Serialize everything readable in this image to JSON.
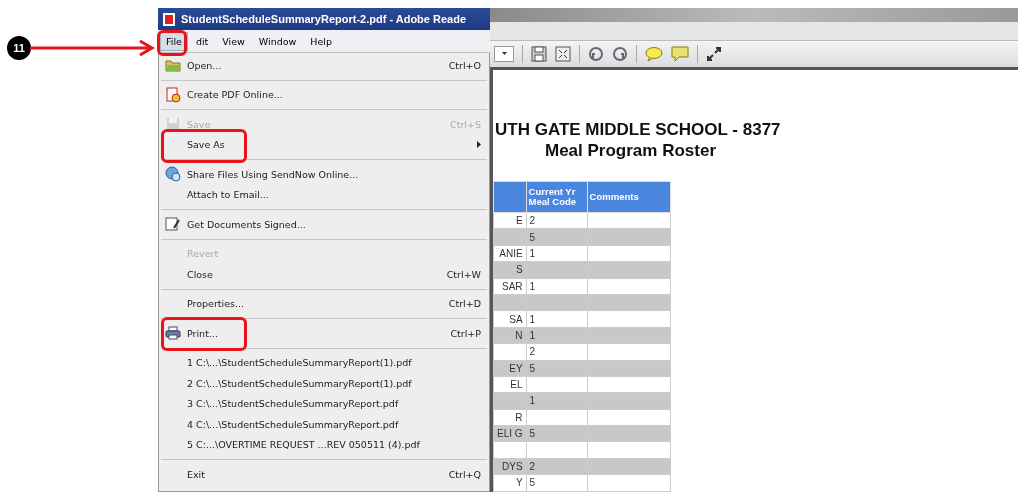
{
  "step_marker": {
    "number": "11"
  },
  "window": {
    "title": "StudentScheduleSummaryReport-2.pdf - Adobe Reade"
  },
  "menu_bar": [
    {
      "label": "File",
      "selected": true,
      "highlighted": true
    },
    {
      "label": "dit",
      "selected": false,
      "highlighted": false
    },
    {
      "label": "View",
      "selected": false,
      "highlighted": false
    },
    {
      "label": "Window",
      "selected": false,
      "highlighted": false
    },
    {
      "label": "Help",
      "selected": false,
      "highlighted": false
    }
  ],
  "file_menu": [
    {
      "kind": "item",
      "label": "Open...",
      "shortcut": "Ctrl+O",
      "disabled": false,
      "highlighted": false
    },
    {
      "kind": "separator"
    },
    {
      "kind": "item",
      "label": "Create PDF Online...",
      "disabled": false,
      "highlighted": false
    },
    {
      "kind": "separator"
    },
    {
      "kind": "item",
      "label": "Save",
      "shortcut": "Ctrl+S",
      "disabled": true,
      "highlighted": false
    },
    {
      "kind": "submenu",
      "label": "Save As",
      "disabled": false,
      "highlighted": true
    },
    {
      "kind": "separator"
    },
    {
      "kind": "item",
      "label": "Share Files Using SendNow Online...",
      "disabled": false,
      "highlighted": false
    },
    {
      "kind": "item",
      "label": "Attach to Email...",
      "disabled": false,
      "highlighted": false
    },
    {
      "kind": "separator"
    },
    {
      "kind": "item",
      "label": "Get Documents Signed...",
      "disabled": false,
      "highlighted": false
    },
    {
      "kind": "separator"
    },
    {
      "kind": "item",
      "label": "Revert",
      "disabled": true,
      "highlighted": false
    },
    {
      "kind": "item",
      "label": "Close",
      "shortcut": "Ctrl+W",
      "disabled": false,
      "highlighted": false
    },
    {
      "kind": "separator"
    },
    {
      "kind": "item",
      "label": "Properties...",
      "shortcut": "Ctrl+D",
      "disabled": false,
      "highlighted": false
    },
    {
      "kind": "separator"
    },
    {
      "kind": "item",
      "label": "Print...",
      "shortcut": "Ctrl+P",
      "disabled": false,
      "highlighted": true
    },
    {
      "kind": "separator"
    },
    {
      "kind": "item",
      "label": "1 C:\\...\\StudentScheduleSummaryReport(1).pdf",
      "disabled": false,
      "highlighted": false
    },
    {
      "kind": "item",
      "label": "2 C:\\...\\StudentScheduleSummaryReport(1).pdf",
      "disabled": false,
      "highlighted": false
    },
    {
      "kind": "item",
      "label": "3 C:\\...\\StudentScheduleSummaryReport.pdf",
      "disabled": false,
      "highlighted": false
    },
    {
      "kind": "item",
      "label": "4 C:\\...\\StudentScheduleSummaryReport.pdf",
      "disabled": false,
      "highlighted": false
    },
    {
      "kind": "item",
      "label": "5 C:...\\OVERTIME REQUEST ...REV 050511 (4).pdf",
      "disabled": false,
      "highlighted": false
    },
    {
      "kind": "separator"
    },
    {
      "kind": "item",
      "label": "Exit",
      "shortcut": "Ctrl+Q",
      "disabled": false,
      "highlighted": false
    }
  ],
  "document": {
    "title": "UTH GATE MIDDLE SCHOOL - 8377",
    "subtitle": "Meal Program Roster",
    "table": {
      "columns": [
        "",
        "Current Yr Meal Code",
        "Comments"
      ],
      "rows": [
        [
          "E",
          "2",
          ""
        ],
        [
          "",
          "5",
          ""
        ],
        [
          "ANIE",
          "1",
          ""
        ],
        [
          "S",
          "",
          ""
        ],
        [
          "SAR",
          "1",
          ""
        ],
        [
          "",
          "",
          ""
        ],
        [
          "SA",
          "1",
          ""
        ],
        [
          "N",
          "1",
          ""
        ],
        [
          "",
          "2",
          ""
        ],
        [
          "EY",
          "5",
          ""
        ],
        [
          "EL",
          "",
          ""
        ],
        [
          "",
          "1",
          ""
        ],
        [
          "R",
          "",
          ""
        ],
        [
          "ELI G",
          "5",
          ""
        ],
        [
          "",
          "",
          ""
        ],
        [
          "DYS",
          "2",
          ""
        ],
        [
          "Y",
          "5",
          ""
        ]
      ]
    }
  }
}
